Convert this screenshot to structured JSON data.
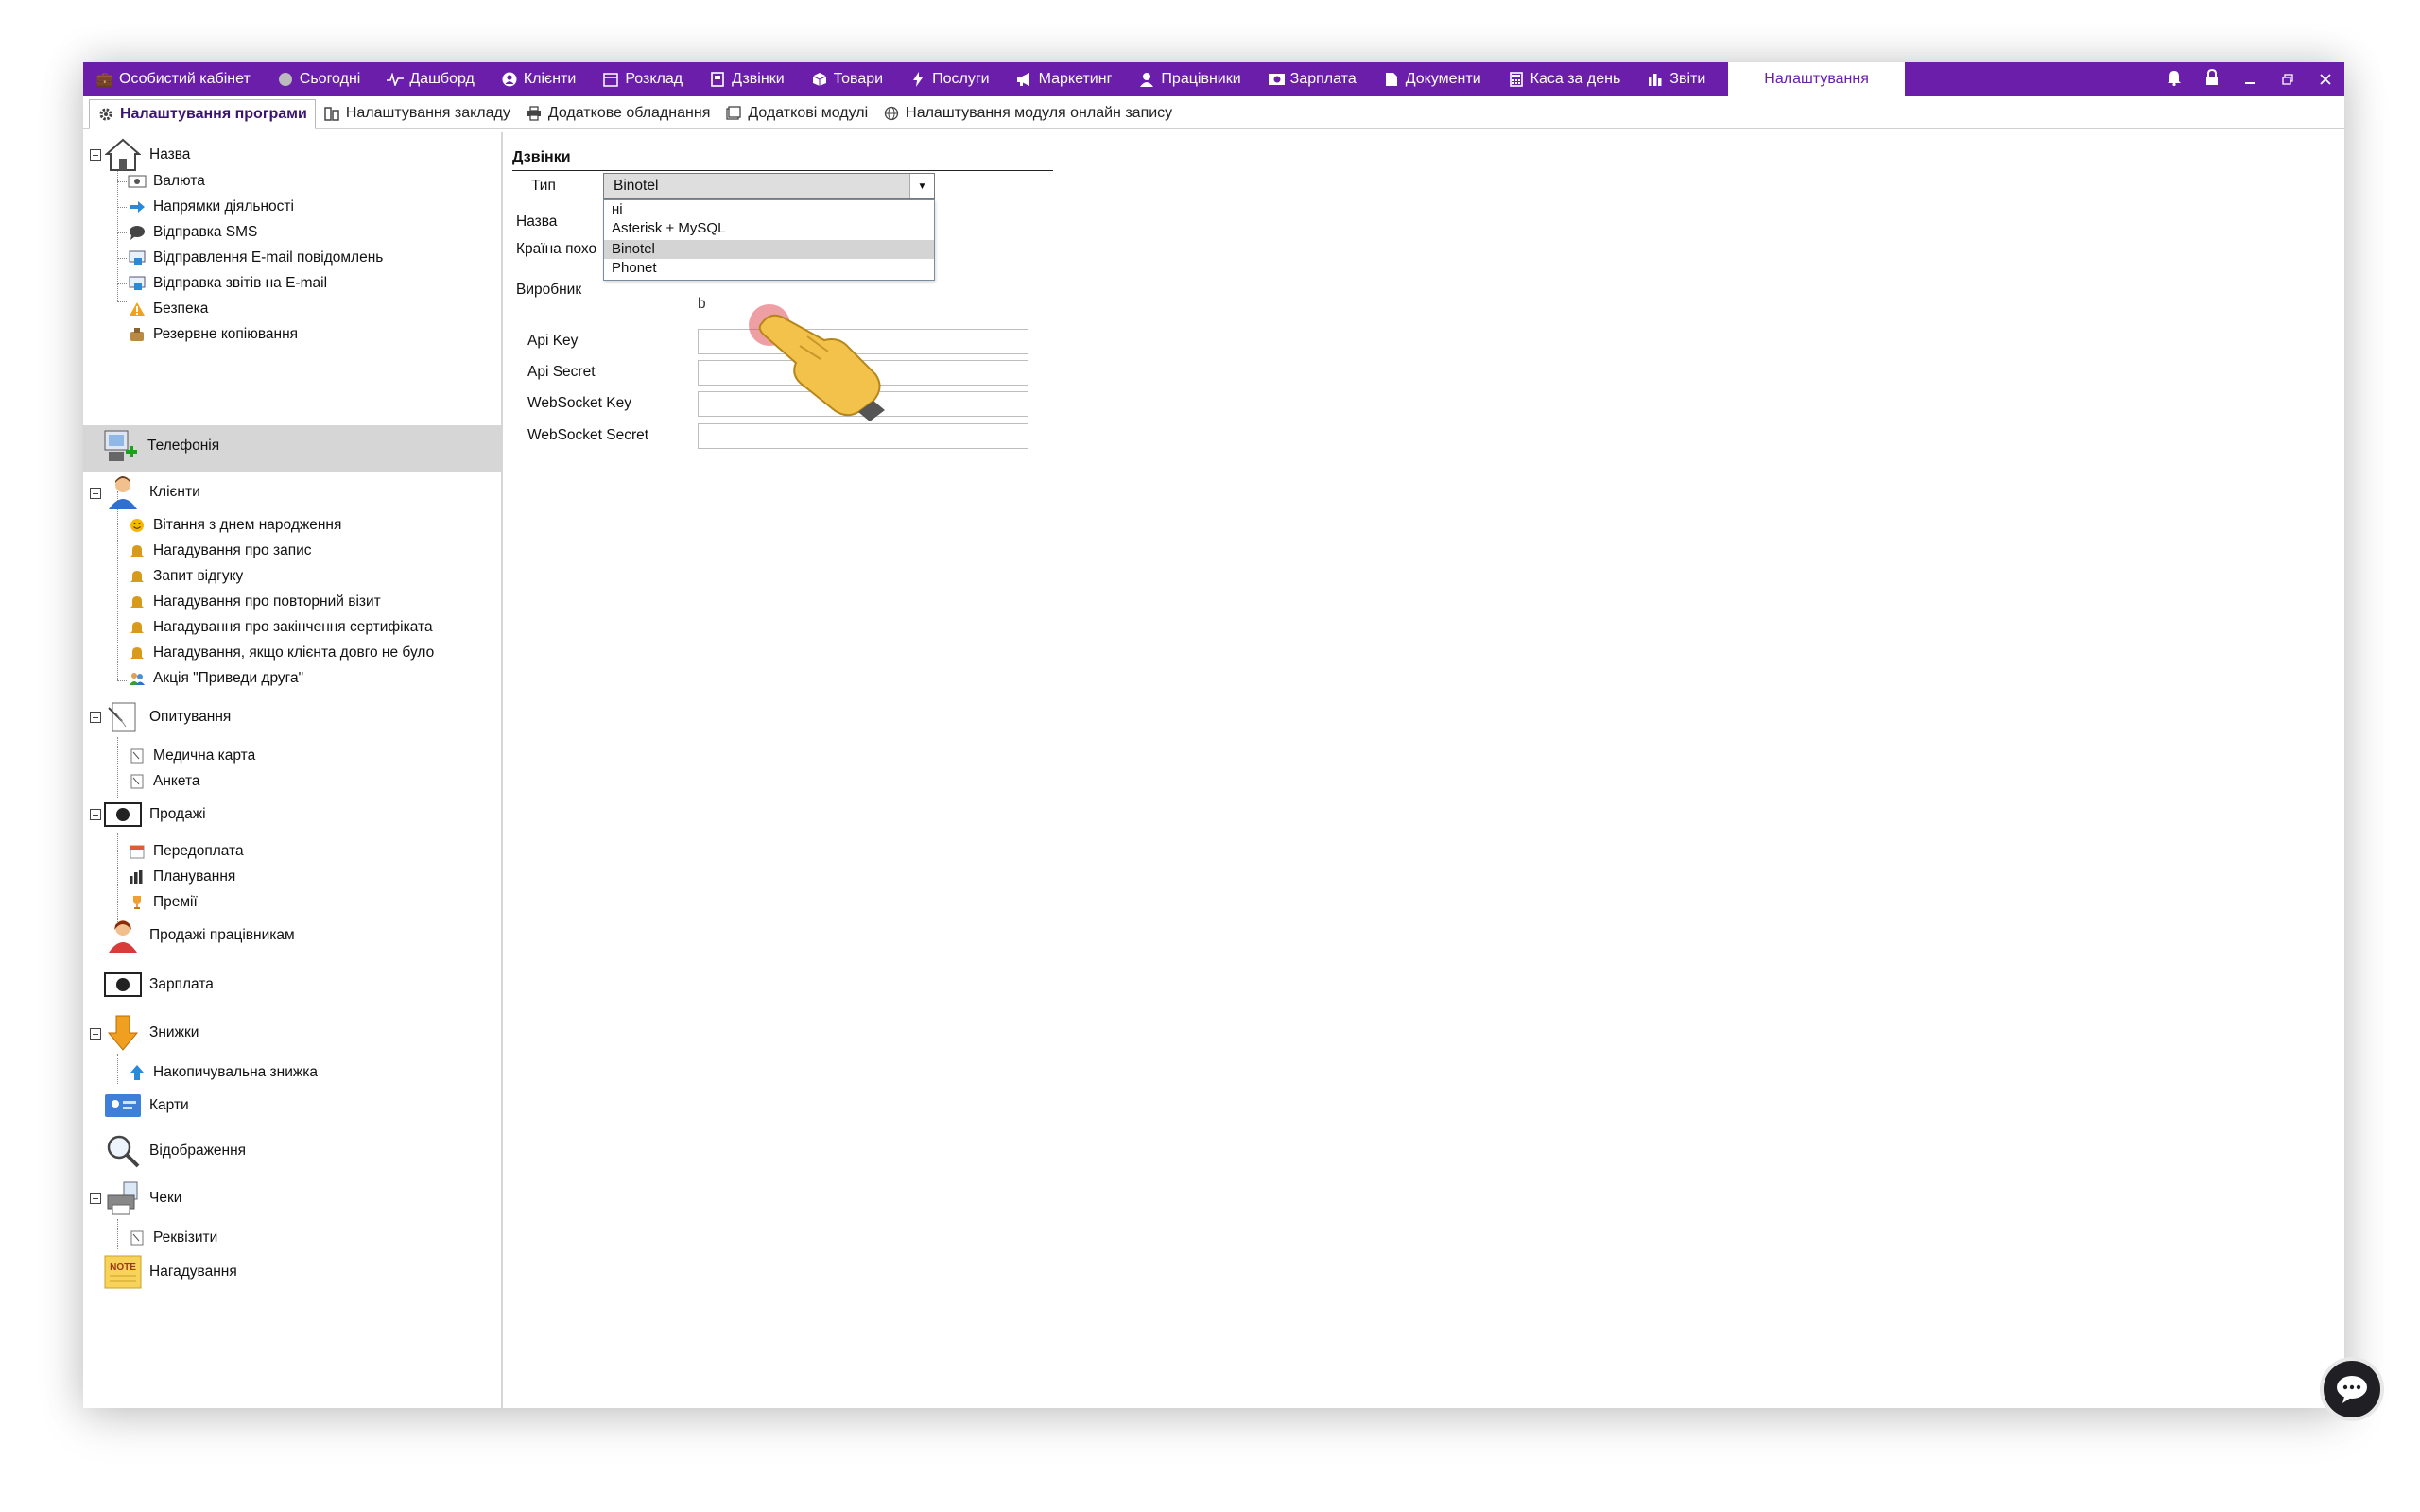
{
  "topnav": {
    "items": [
      {
        "label": "Особистий кабінет",
        "icon": "briefcase-icon"
      },
      {
        "label": "Сьогодні",
        "icon": "clock-icon"
      },
      {
        "label": "Дашборд",
        "icon": "pulse-icon"
      },
      {
        "label": "Клієнти",
        "icon": "user-circle-icon"
      },
      {
        "label": "Розклад",
        "icon": "calendar-icon"
      },
      {
        "label": "Дзвінки",
        "icon": "phone-book-icon"
      },
      {
        "label": "Товари",
        "icon": "box-icon"
      },
      {
        "label": "Послуги",
        "icon": "lightning-icon"
      },
      {
        "label": "Маркетинг",
        "icon": "megaphone-icon"
      },
      {
        "label": "Працівники",
        "icon": "person-icon"
      },
      {
        "label": "Зарплата",
        "icon": "money-icon"
      },
      {
        "label": "Документи",
        "icon": "document-icon"
      },
      {
        "label": "Каса за день",
        "icon": "calculator-icon"
      },
      {
        "label": "Звіти",
        "icon": "bar-chart-icon"
      }
    ],
    "active_label": "Налаштування",
    "controls": [
      "bell-icon",
      "lock-icon",
      "minimize-icon",
      "restore-icon",
      "close-icon"
    ],
    "bg_color": "#6a1ea9"
  },
  "subnav": {
    "items": [
      {
        "label": "Налаштування програми",
        "icon": "gear-icon",
        "active": true
      },
      {
        "label": "Налаштування закладу",
        "icon": "building-icon"
      },
      {
        "label": "Додаткове обладнання",
        "icon": "printer-icon"
      },
      {
        "label": "Додаткові модулі",
        "icon": "window-icon"
      },
      {
        "label": "Налаштування модуля онлайн запису",
        "icon": "globe-icon"
      }
    ]
  },
  "tree": {
    "nodes": {
      "nazva": "Назва",
      "valyuta": "Валюта",
      "napryamky": "Напрямки діяльності",
      "sms": "Відправка SMS",
      "email_notif": "Відправлення E-mail повідомлень",
      "email_reports": "Відправка звітів на E-mail",
      "bezpeka": "Безпека",
      "backup": "Резервне копіювання",
      "telephonia": "Телефонія",
      "klienty": "Клієнти",
      "birthday": "Вітання з днем народження",
      "remind_record": "Нагадування про запис",
      "feedback": "Запит відгуку",
      "repeat_visit": "Нагадування про повторний візит",
      "cert_end": "Нагадування про закінчення сертифіката",
      "long_absent": "Нагадування, якщо клієнта довго не було",
      "bring_friend": "Акція \"Приведи друга\"",
      "survey": "Опитування",
      "med_card": "Медична карта",
      "anketa": "Анкета",
      "prodazhi": "Продажі",
      "prepay": "Передоплата",
      "planning": "Планування",
      "bonuses": "Премії",
      "staff_sales": "Продажі працівникам",
      "zarplata": "Зарплата",
      "discounts": "Знижки",
      "cumulative": "Накопичувальна знижка",
      "cards": "Карти",
      "display": "Відображення",
      "receipts": "Чеки",
      "requisites": "Реквізити",
      "reminders": "Нагадування",
      "note_badge": "NOTE"
    }
  },
  "content": {
    "section_title": "Дзвінки",
    "type_label": "Тип",
    "type_value": "Binotel",
    "name_label": "Назва",
    "country_label": "Країна похо",
    "manufacturer_label": "Виробник",
    "api_key_label": "Api Key",
    "api_secret_label": "Api Secret",
    "ws_key_label": "WebSocket Key",
    "ws_secret_label": "WebSocket Secret",
    "dropdown_options": [
      "ні",
      "Asterisk + MySQL",
      "Binotel",
      "Phonet"
    ],
    "highlighted_option": "Binotel",
    "hidden_text_fragment": "b"
  }
}
